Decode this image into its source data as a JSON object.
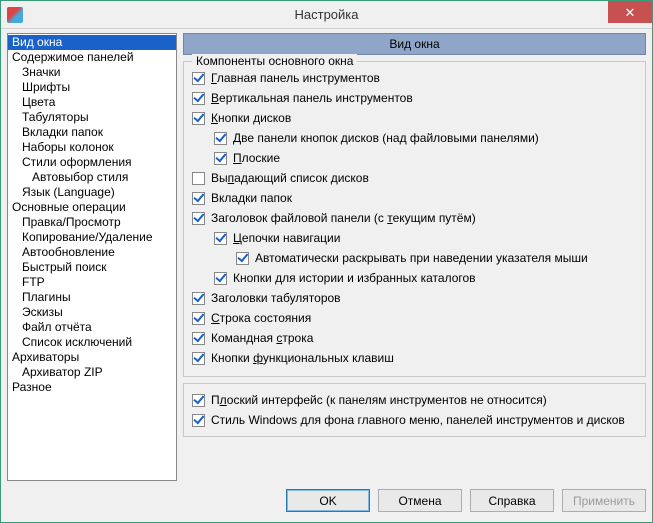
{
  "window": {
    "title": "Настройка"
  },
  "tree": [
    {
      "label": "Вид окна",
      "depth": 0,
      "selected": true
    },
    {
      "label": "Содержимое панелей",
      "depth": 0
    },
    {
      "label": "Значки",
      "depth": 1
    },
    {
      "label": "Шрифты",
      "depth": 1
    },
    {
      "label": "Цвета",
      "depth": 1
    },
    {
      "label": "Табуляторы",
      "depth": 1
    },
    {
      "label": "Вкладки папок",
      "depth": 1
    },
    {
      "label": "Наборы колонок",
      "depth": 1
    },
    {
      "label": "Стили оформления",
      "depth": 1
    },
    {
      "label": "Автовыбор стиля",
      "depth": 2
    },
    {
      "label": "Язык (Language)",
      "depth": 1
    },
    {
      "label": "Основные операции",
      "depth": 0
    },
    {
      "label": "Правка/Просмотр",
      "depth": 1
    },
    {
      "label": "Копирование/Удаление",
      "depth": 1
    },
    {
      "label": "Автообновление",
      "depth": 1
    },
    {
      "label": "Быстрый поиск",
      "depth": 1
    },
    {
      "label": "FTP",
      "depth": 1
    },
    {
      "label": "Плагины",
      "depth": 1
    },
    {
      "label": "Эскизы",
      "depth": 1
    },
    {
      "label": "Файл отчёта",
      "depth": 1
    },
    {
      "label": "Список исключений",
      "depth": 1
    },
    {
      "label": "Архиваторы",
      "depth": 0
    },
    {
      "label": "Архиватор ZIP",
      "depth": 1
    },
    {
      "label": "Разное",
      "depth": 0
    }
  ],
  "page": {
    "title": "Вид окна",
    "group_label": "Компоненты основного окна"
  },
  "options": [
    {
      "text": "Главная панель инструментов",
      "u": 0,
      "checked": true,
      "depth": 0
    },
    {
      "text": "Вертикальная панель инструментов",
      "u": 0,
      "checked": true,
      "depth": 0
    },
    {
      "text": "Кнопки дисков",
      "u": 0,
      "checked": true,
      "depth": 0
    },
    {
      "text": "Две панели кнопок дисков (над файловыми панелями)",
      "u": 0,
      "checked": true,
      "depth": 1
    },
    {
      "text": "Плоские",
      "u": 0,
      "checked": true,
      "depth": 1
    },
    {
      "text": "Выпадающий список дисков",
      "u": 2,
      "checked": false,
      "depth": 0
    },
    {
      "text": "Вкладки папок",
      "u": -1,
      "checked": true,
      "depth": 0
    },
    {
      "text": "Заголовок файловой панели (с текущим путём)",
      "u": 29,
      "checked": true,
      "depth": 0
    },
    {
      "text": "Цепочки навигации",
      "u": 0,
      "checked": true,
      "depth": 1
    },
    {
      "text": "Автоматически раскрывать при наведении указателя мыши",
      "u": -1,
      "checked": true,
      "depth": 2
    },
    {
      "text": "Кнопки для истории и избранных каталогов",
      "u": -1,
      "checked": true,
      "depth": 1
    },
    {
      "text": "Заголовки табуляторов",
      "u": -1,
      "checked": true,
      "depth": 0
    },
    {
      "text": "Строка состояния",
      "u": 0,
      "checked": true,
      "depth": 0
    },
    {
      "text": "Командная строка",
      "u": 10,
      "checked": true,
      "depth": 0
    },
    {
      "text": "Кнопки функциональных клавиш",
      "u": 7,
      "checked": true,
      "depth": 0
    }
  ],
  "options2": [
    {
      "text": "Плоский интерфейс (к панелям инструментов не относится)",
      "u": 1,
      "checked": true
    },
    {
      "text": "Стиль Windows для фона главного меню, панелей инструментов и дисков",
      "u": -1,
      "checked": true
    }
  ],
  "buttons": {
    "ok": "OK",
    "cancel": "Отмена",
    "help": "Справка",
    "apply": "Применить"
  }
}
